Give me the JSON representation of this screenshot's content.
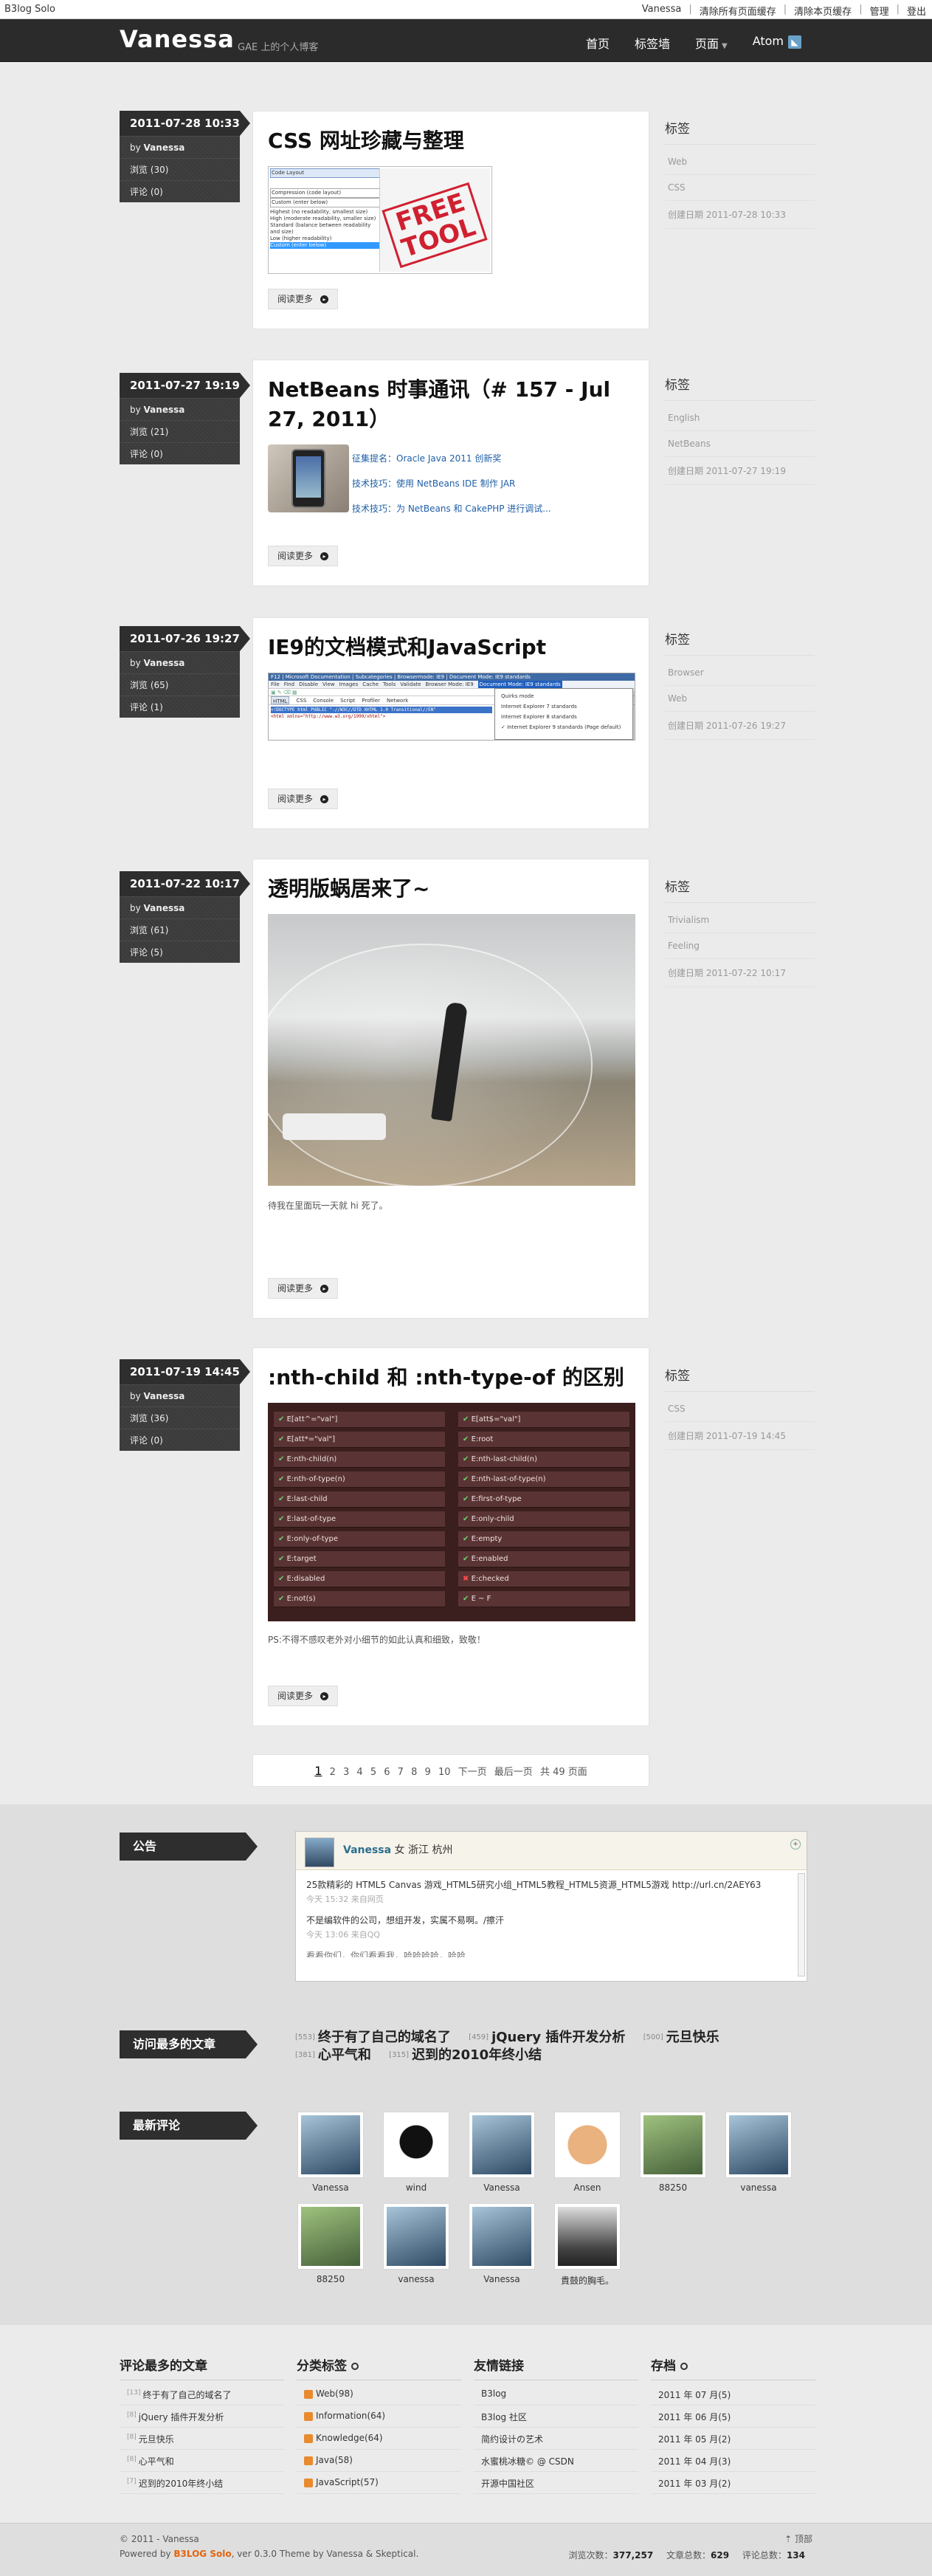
{
  "topbar": {
    "brand": "B3log Solo",
    "user": "Vanessa",
    "links": [
      "清除所有页面缓存",
      "清除本页缓存",
      "管理",
      "登出"
    ]
  },
  "header": {
    "logo": "Vanessa",
    "subtitle": "GAE 上的个人博客",
    "nav": [
      "首页",
      "标签墙",
      "页面",
      "Atom"
    ]
  },
  "articles": [
    {
      "date": "2011-07-28 10:33",
      "by": "Vanessa",
      "views": "浏览 (30)",
      "comments": "评论 (0)",
      "title": "CSS 网址珍藏与整理",
      "readmore": "阅读更多",
      "side": {
        "heading": "标签",
        "tags": [
          "Web",
          "CSS"
        ],
        "created": "创建日期 2011-07-28 10:33"
      },
      "image_text": {
        "stamp": "FREE TOOL",
        "lines": [
          "Code Layout",
          "Compression (code layout)",
          "Custom (enter below)",
          "Highest (no readability, smallest size)",
          "High (moderate readability, smaller size)",
          "Standard (balance between readability and size)",
          "Low (higher readability)",
          "Custom (enter below)"
        ]
      }
    },
    {
      "date": "2011-07-27 19:19",
      "by": "Vanessa",
      "views": "浏览 (21)",
      "comments": "评论 (0)",
      "title": "NetBeans 时事通讯（# 157 - Jul 27, 2011）",
      "readmore": "阅读更多",
      "links": [
        "征集提名：Oracle Java 2011 创新奖",
        "技术技巧：使用 NetBeans IDE 制作 JAR",
        "技术技巧：为 NetBeans 和 CakePHP 进行调试..."
      ],
      "side": {
        "heading": "标签",
        "tags": [
          "English",
          "NetBeans"
        ],
        "created": "创建日期 2011-07-27 19:19"
      }
    },
    {
      "date": "2011-07-26 19:27",
      "by": "Vanessa",
      "views": "浏览 (65)",
      "comments": "评论 (1)",
      "title": "IE9的文档模式和JavaScript",
      "readmore": "阅读更多",
      "side": {
        "heading": "标签",
        "tags": [
          "Browser",
          "Web"
        ],
        "created": "创建日期 2011-07-26 19:27"
      },
      "image_text": {
        "titlebar": "F12 | Microsoft Documentation | Subcategories | Browsermode: IE9 | Document Mode: IE9 standards",
        "menus": [
          "File",
          "Find",
          "Disable",
          "View",
          "Images",
          "Cache",
          "Tools",
          "Validate",
          "Browser Mode: IE9",
          "Document Mode: IE9 standards"
        ],
        "tabs": [
          "HTML",
          "CSS",
          "Console",
          "Script",
          "Profiler",
          "Network"
        ],
        "code1": "<!DOCTYPE html PUBLIC \"-//W3C//DTD XHTML 1.0 Transitional//EN\"",
        "code2": "<html xmlns=\"http://www.w3.org/1999/xhtml\">",
        "dropdown": [
          "Quirks mode",
          "Internet Explorer 7 standards",
          "Internet Explorer 8 standards",
          "Internet Explorer 9 standards (Page default)"
        ]
      }
    },
    {
      "date": "2011-07-22 10:17",
      "by": "Vanessa",
      "views": "浏览 (61)",
      "comments": "评论 (5)",
      "title": "透明版蜗居来了~",
      "readmore": "阅读更多",
      "caption": "待我在里面玩一天就 hi 死了。",
      "side": {
        "heading": "标签",
        "tags": [
          "Trivialism",
          "Feeling"
        ],
        "created": "创建日期 2011-07-22 10:17"
      }
    },
    {
      "date": "2011-07-19 14:45",
      "by": "Vanessa",
      "views": "浏览 (36)",
      "comments": "评论 (0)",
      "title": ":nth-child 和 :nth-type-of 的区别",
      "readmore": "阅读更多",
      "caption": "PS:不得不感叹老外对小细节的如此认真和细致，致敬！",
      "selectors_left": [
        "E[att^=\"val\"]",
        "E[att*=\"val\"]",
        "E:nth-child(n)",
        "E:nth-of-type(n)",
        "E:last-child",
        "E:last-of-type",
        "E:only-of-type",
        "E:target",
        "E:disabled",
        "E:not(s)"
      ],
      "selectors_right": [
        "E[att$=\"val\"]",
        "E:root",
        "E:nth-last-child(n)",
        "E:nth-last-of-type(n)",
        "E:first-of-type",
        "E:only-child",
        "E:empty",
        "E:enabled",
        "E:checked",
        "E ~ F"
      ],
      "right_states": [
        "ok",
        "ok",
        "ok",
        "ok",
        "ok",
        "ok",
        "ok",
        "ok",
        "x",
        "ok"
      ],
      "side": {
        "heading": "标签",
        "tags": [
          "CSS"
        ],
        "created": "创建日期 2011-07-19 14:45"
      }
    }
  ],
  "pager": {
    "pages": [
      "1",
      "2",
      "3",
      "4",
      "5",
      "6",
      "7",
      "8",
      "9",
      "10"
    ],
    "next": "下一页",
    "last": "最后一页",
    "total": "共 49 页面"
  },
  "widgets": {
    "notice_title": "公告",
    "notice": {
      "name": "Vanessa",
      "info": "女 浙江 杭州",
      "msg1": "25款精彩的 HTML5 Canvas 游戏_HTML5研究小组_HTML5教程_HTML5资源_HTML5游戏 http://url.cn/2AEY63",
      "time1": "今天 15:32 来自网页",
      "msg2": "不是编软件的公司，想组开发，实属不易啊。/擦汗",
      "time2": "今天 13:06 来自QQ",
      "msg3": "看看你们，你们看看我，哈哈哈哈，哈哈..."
    },
    "hot_title": "访问最多的文章",
    "hot": [
      {
        "n": "[553]",
        "t": "终于有了自己的域名了"
      },
      {
        "n": "[459]",
        "t": "jQuery 插件开发分析"
      },
      {
        "n": "[500]",
        "t": "元旦快乐"
      },
      {
        "n": "[381]",
        "t": "心平气和"
      },
      {
        "n": "[315]",
        "t": "迟到的2010年终小结"
      }
    ],
    "comments_title": "最新评论",
    "commenters": [
      "Vanessa",
      "wind",
      "Vanessa",
      "Ansen",
      "88250",
      "vanessa",
      "88250",
      "vanessa",
      "Vanessa",
      "貴鼓的胸毛。"
    ]
  },
  "footer": {
    "cols": [
      {
        "title": "评论最多的文章",
        "items": [
          [
            "[13]",
            "终于有了自己的域名了"
          ],
          [
            "[8]",
            "jQuery 插件开发分析"
          ],
          [
            "[8]",
            "元旦快乐"
          ],
          [
            "[8]",
            "心平气和"
          ],
          [
            "[7]",
            "迟到的2010年终小结"
          ]
        ]
      },
      {
        "title": "分类标签",
        "items": [
          "Web(98)",
          "Information(64)",
          "Knowledge(64)",
          "Java(58)",
          "JavaScript(57)"
        ]
      },
      {
        "title": "友情链接",
        "items": [
          "B3log",
          "B3log 社区",
          "简约设计の艺术",
          "水蜜桃冰糖© @ CSDN",
          "开源中国社区"
        ]
      },
      {
        "title": "存档",
        "items": [
          "2011 年 07 月(5)",
          "2011 年 06 月(5)",
          "2011 年 05 月(2)",
          "2011 年 04 月(3)",
          "2011 年 03 月(2)"
        ]
      }
    ]
  },
  "bottom": {
    "copyright": "© 2011 - Vanessa",
    "powered": "Powered by",
    "product": "B3LOG Solo",
    "version": ", ver 0.3.0",
    "theme": "Theme by Vanessa & Skeptical.",
    "stats": [
      {
        "label": "浏览次数：",
        "value": "377,257"
      },
      {
        "label": "文章总数：",
        "value": "629"
      },
      {
        "label": "评论总数：",
        "value": "134"
      }
    ],
    "top": "顶部"
  }
}
